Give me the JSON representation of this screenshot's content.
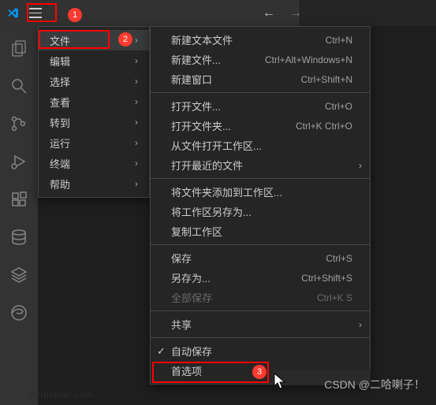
{
  "badges": {
    "b1": "1",
    "b2": "2",
    "b3": "3"
  },
  "mainMenu": {
    "file": "文件",
    "edit": "编辑",
    "selection": "选择",
    "view": "查看",
    "go": "转到",
    "run": "运行",
    "terminal": "终端",
    "help": "帮助"
  },
  "submenu": {
    "newTextFile": {
      "label": "新建文本文件",
      "shortcut": "Ctrl+N"
    },
    "newFile": {
      "label": "新建文件...",
      "shortcut": "Ctrl+Alt+Windows+N"
    },
    "newWindow": {
      "label": "新建窗口",
      "shortcut": "Ctrl+Shift+N"
    },
    "openFile": {
      "label": "打开文件...",
      "shortcut": "Ctrl+O"
    },
    "openFolder": {
      "label": "打开文件夹...",
      "shortcut": "Ctrl+K Ctrl+O"
    },
    "openWorkspace": {
      "label": "从文件打开工作区..."
    },
    "openRecent": {
      "label": "打开最近的文件"
    },
    "addFolder": {
      "label": "将文件夹添加到工作区..."
    },
    "saveWorkspaceAs": {
      "label": "将工作区另存为..."
    },
    "duplicateWorkspace": {
      "label": "复制工作区"
    },
    "save": {
      "label": "保存",
      "shortcut": "Ctrl+S"
    },
    "saveAs": {
      "label": "另存为...",
      "shortcut": "Ctrl+Shift+S"
    },
    "saveAll": {
      "label": "全部保存",
      "shortcut": "Ctrl+K S"
    },
    "share": {
      "label": "共享"
    },
    "autoSave": {
      "label": "自动保存"
    },
    "preferences": {
      "label": "首选项"
    }
  },
  "watermark": "CSDN @二哈喇子！"
}
